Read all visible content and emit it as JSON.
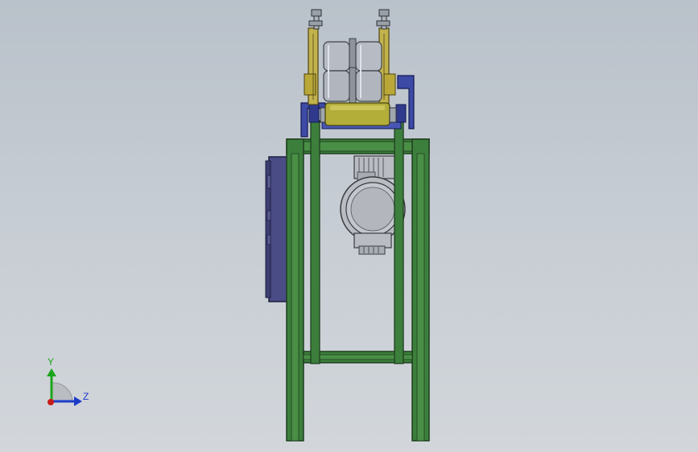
{
  "viewport": {
    "background_top": "#b9c1ca",
    "background_bottom": "#d2d6db"
  },
  "model": {
    "parts": {
      "frame": {
        "color": "#3c7f3c",
        "edge": "#1f3f1f"
      },
      "control_box": {
        "color": "#4a4c86",
        "edge": "#1d1e40"
      },
      "motor": {
        "color": "#b9bcc2",
        "edge": "#3a3c40"
      },
      "rollers": {
        "color": "#b6bbc4",
        "edge": "#3e4248"
      },
      "pressure_roller": {
        "color": "#b3ad3a",
        "edge": "#4a4710"
      },
      "bracket": {
        "color": "#3d4aa6",
        "edge": "#141a52"
      },
      "adjust_arm": {
        "color": "#c2b24c",
        "edge": "#4e4515"
      },
      "bolts": {
        "color": "#9aa0a8",
        "edge": "#2c3036"
      }
    }
  },
  "triad": {
    "y_label": "Y",
    "z_label": "Z",
    "y_color": "#1aa51a",
    "z_color": "#1c3cc8",
    "x_color": "#c81c1c"
  }
}
